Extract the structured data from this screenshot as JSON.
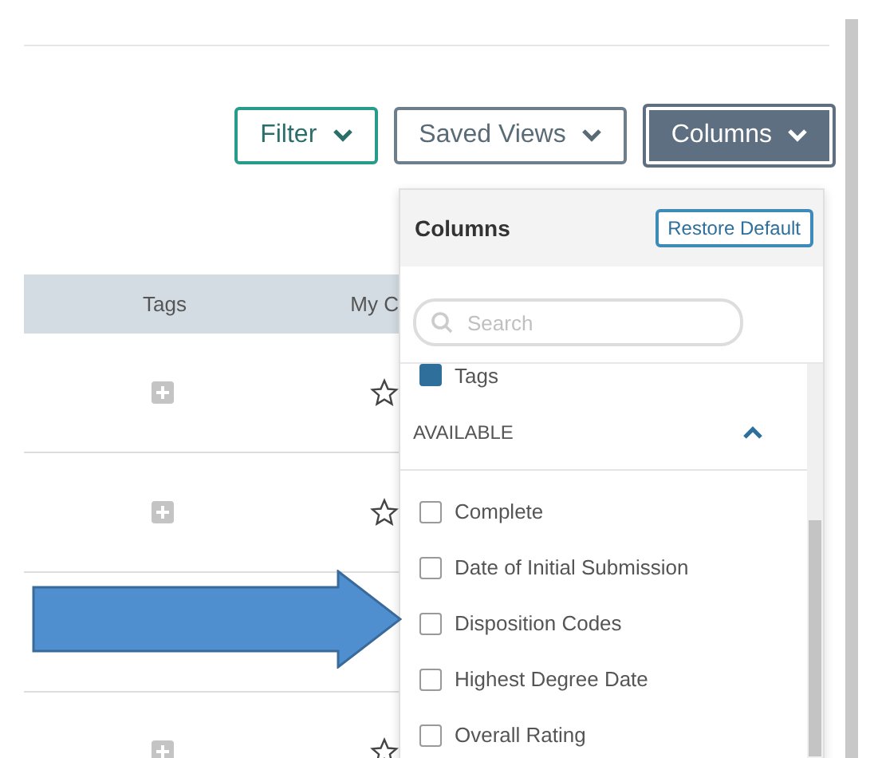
{
  "toolbar": {
    "buttons": [
      {
        "label": "Filter",
        "kind": "outline-teal"
      },
      {
        "label": "Saved Views",
        "kind": "outline-gray"
      },
      {
        "label": "Columns",
        "kind": "filled",
        "expanded": true
      }
    ]
  },
  "table": {
    "columns": [
      "Tags",
      "My C"
    ],
    "rows": [
      {
        "kind": "item",
        "starred": false
      },
      {
        "kind": "item",
        "starred": false
      },
      {
        "kind": "blank"
      },
      {
        "kind": "item",
        "starred": false
      }
    ]
  },
  "columns_menu": {
    "title": "Columns",
    "restore_button": "Restore Default",
    "search": {
      "placeholder": "Search"
    },
    "selected_items": [
      {
        "label": "Tags",
        "checked": true
      }
    ],
    "available_section": {
      "label": "AVAILABLE",
      "expanded": true,
      "items": [
        {
          "label": "Complete",
          "checked": false
        },
        {
          "label": "Date of Initial Submission",
          "checked": false
        },
        {
          "label": "Disposition Codes",
          "checked": false
        },
        {
          "label": "Highest Degree Date",
          "checked": false
        },
        {
          "label": "Overall Rating",
          "checked": false
        }
      ]
    }
  }
}
